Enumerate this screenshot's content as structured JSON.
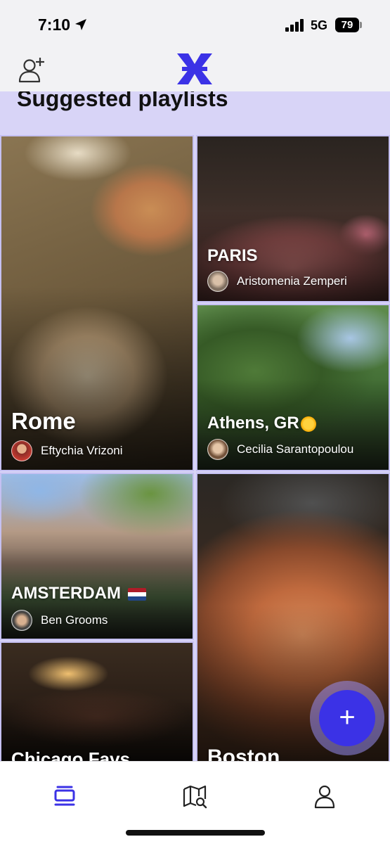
{
  "status_bar": {
    "time": "7:10",
    "network": "5G",
    "battery": "79"
  },
  "header": {
    "add_user_icon": "add-user-icon",
    "logo_icon": "x-logo-icon"
  },
  "section": {
    "title": "Suggested playlists"
  },
  "playlists": [
    {
      "title": "Rome",
      "author": "Eftychia Vrizoni"
    },
    {
      "title": "PARIS",
      "author": "Aristomenia Zemperi"
    },
    {
      "title": "Athens, GR",
      "author": "Cecilia Sarantopoulou"
    },
    {
      "title": "AMSTERDAM",
      "author": "Ben Grooms"
    },
    {
      "title": "Chicago Favs"
    },
    {
      "title": "Boston"
    }
  ],
  "fab": {
    "label": "+"
  },
  "tab_bar": {
    "items": [
      "playlists-icon",
      "map-search-icon",
      "profile-icon"
    ]
  },
  "colors": {
    "accent": "#3b32e6",
    "section_bg": "#d8d4f7"
  }
}
